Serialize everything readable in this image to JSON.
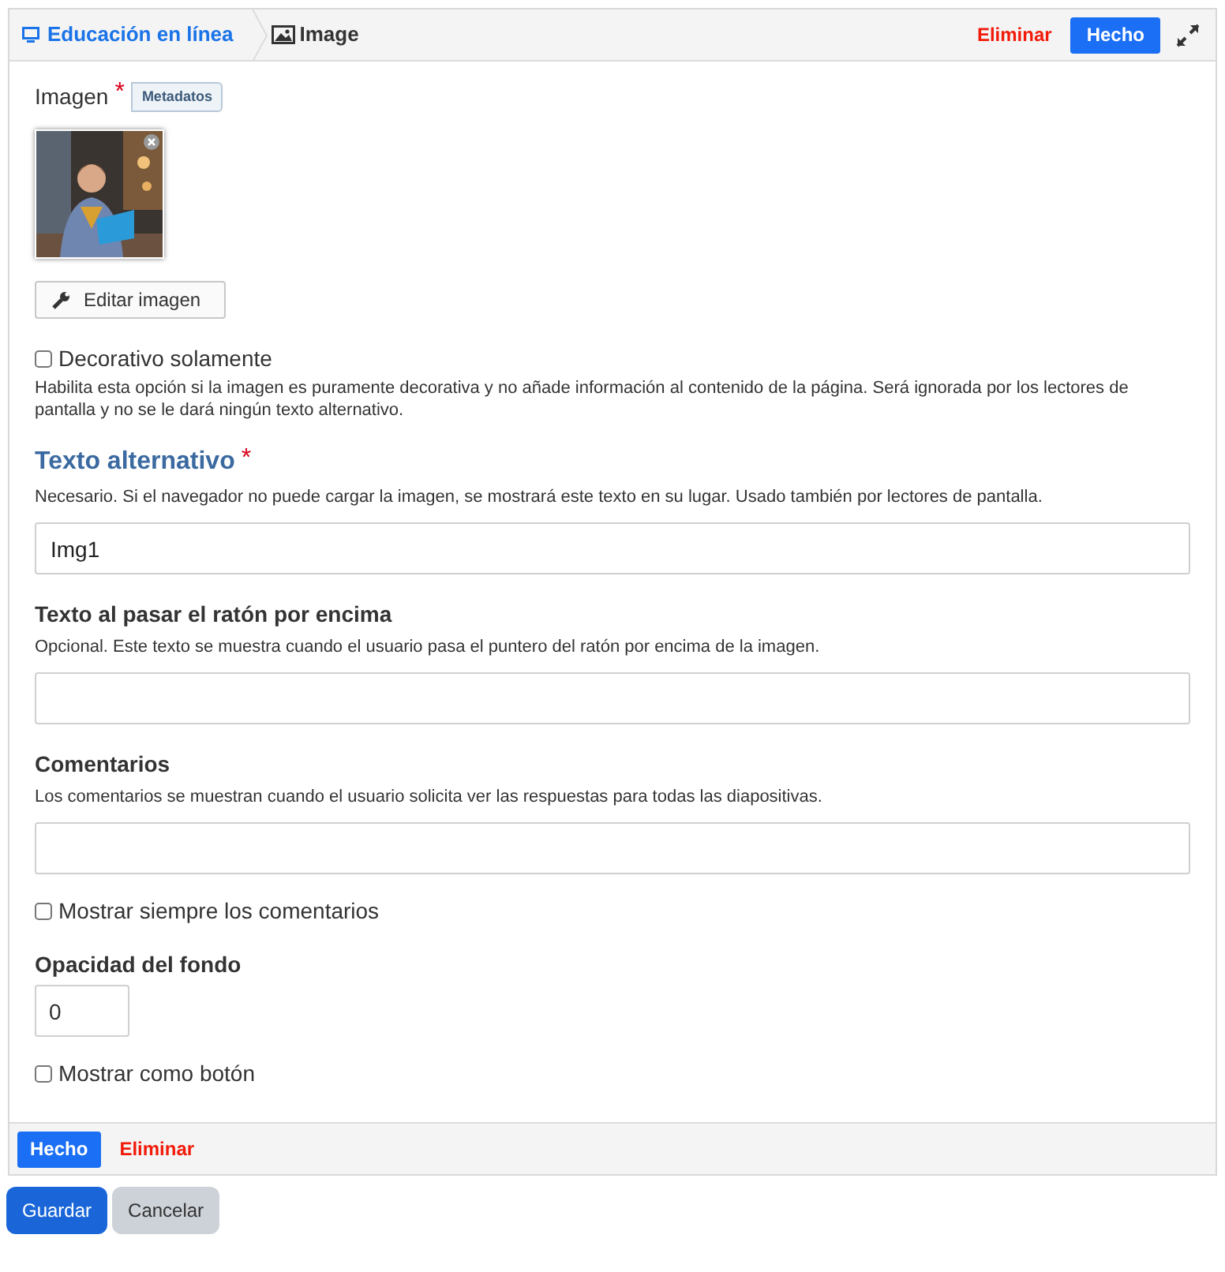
{
  "header": {
    "breadcrumb": "Educación en línea",
    "title": "Image",
    "delete": "Eliminar",
    "done": "Hecho"
  },
  "image_field": {
    "label": "Imagen",
    "required_mark": "*",
    "tag": "Metadatos",
    "edit_button": "Editar imagen"
  },
  "fields": [
    {
      "kind": "checkbox",
      "label": "Decorativo solamente",
      "checked": false,
      "description": "Habilita esta opción si la imagen es puramente decorativa y no añade información al contenido de la página. Será ignorada por los lectores de pantalla y no se le dará ningún texto alternativo."
    },
    {
      "kind": "text",
      "label": "Texto alternativo",
      "required_mark": "*",
      "highlighted": true,
      "description": "Necesario. Si el navegador no puede cargar la imagen, se mostrará este texto en su lugar. Usado también por lectores de pantalla.",
      "value": "Img1"
    },
    {
      "kind": "text",
      "label": "Texto al pasar el ratón por encima",
      "highlighted": false,
      "description": "Opcional. Este texto se muestra cuando el usuario pasa el puntero del ratón por encima de la imagen."
    },
    {
      "kind": "text",
      "label": "Comentarios",
      "highlighted": false,
      "description": "Los comentarios se muestran cuando el usuario solicita ver las respuestas para todas las diapositivas."
    },
    {
      "kind": "checkbox",
      "label": "Mostrar siempre los comentarios",
      "checked": false
    },
    {
      "kind": "number",
      "label": "Opacidad del fondo",
      "value": "0"
    },
    {
      "kind": "checkbox",
      "label": "Mostrar como botón",
      "checked": false
    }
  ],
  "footer": {
    "done": "Hecho",
    "delete": "Eliminar"
  },
  "actions": {
    "save": "Guardar",
    "cancel": "Cancelar"
  }
}
